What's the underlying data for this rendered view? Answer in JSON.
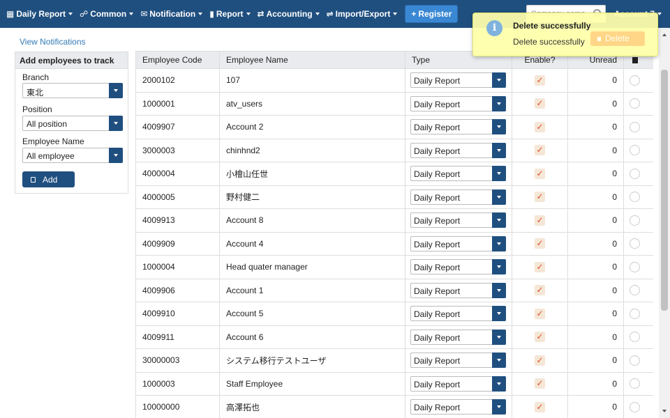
{
  "nav": {
    "items": [
      {
        "icon": "calendar-icon",
        "glyph": "▦",
        "label": "Daily Report",
        "caret": true
      },
      {
        "icon": "users-icon",
        "glyph": "☍",
        "label": "Common",
        "caret": true
      },
      {
        "icon": "envelope-icon",
        "glyph": "✉",
        "label": "Notification",
        "caret": true
      },
      {
        "icon": "bar-chart-icon",
        "glyph": "▮",
        "label": "Report",
        "caret": true
      },
      {
        "icon": "exchange-icon",
        "glyph": "⇄",
        "label": "Accounting",
        "caret": true
      },
      {
        "icon": "transfer-icon",
        "glyph": "⇌",
        "label": "Import/Export",
        "caret": true
      }
    ],
    "register_label": "Register",
    "search_placeholder": "Company name",
    "account_label": "Account 7"
  },
  "sidebar": {
    "view_notifications": "View Notifications",
    "panel_title": "Add employees to track",
    "branch_label": "Branch",
    "branch_value": "東北",
    "position_label": "Position",
    "position_value": "All position",
    "employee_name_label": "Employee Name",
    "employee_name_value": "All employee",
    "add_label": "Add"
  },
  "table": {
    "headers": {
      "code": "Employee Code",
      "name": "Employee Name",
      "type": "Type",
      "enable": "Enable?",
      "unread": "Unread"
    },
    "rows": [
      {
        "code": "2000102",
        "name": "107",
        "type": "Daily Report",
        "enabled": true,
        "unread": "0"
      },
      {
        "code": "1000001",
        "name": "atv_users",
        "type": "Daily Report",
        "enabled": true,
        "unread": "0"
      },
      {
        "code": "4009907",
        "name": "Account 2",
        "type": "Daily Report",
        "enabled": true,
        "unread": "0"
      },
      {
        "code": "3000003",
        "name": "chinhnd2",
        "type": "Daily Report",
        "enabled": true,
        "unread": "0"
      },
      {
        "code": "4000004",
        "name": "小檜山任世",
        "type": "Daily Report",
        "enabled": true,
        "unread": "0"
      },
      {
        "code": "4000005",
        "name": "野村健二",
        "type": "Daily Report",
        "enabled": true,
        "unread": "0"
      },
      {
        "code": "4009913",
        "name": "Account 8",
        "type": "Daily Report",
        "enabled": true,
        "unread": "0"
      },
      {
        "code": "4009909",
        "name": "Account 4",
        "type": "Daily Report",
        "enabled": true,
        "unread": "0"
      },
      {
        "code": "1000004",
        "name": "Head quater manager",
        "type": "Daily Report",
        "enabled": true,
        "unread": "0"
      },
      {
        "code": "4009906",
        "name": "Account 1",
        "type": "Daily Report",
        "enabled": true,
        "unread": "0"
      },
      {
        "code": "4009910",
        "name": "Account 5",
        "type": "Daily Report",
        "enabled": true,
        "unread": "0"
      },
      {
        "code": "4009911",
        "name": "Account 6",
        "type": "Daily Report",
        "enabled": true,
        "unread": "0"
      },
      {
        "code": "30000003",
        "name": "システム移行テストユーザ",
        "type": "Daily Report",
        "enabled": true,
        "unread": "0"
      },
      {
        "code": "1000003",
        "name": "Staff Employee",
        "type": "Daily Report",
        "enabled": true,
        "unread": "0"
      },
      {
        "code": "10000000",
        "name": "高澤拓也",
        "type": "Daily Report",
        "enabled": true,
        "unread": "0"
      }
    ]
  },
  "toast": {
    "title": "Delete successfully",
    "message": "Delete successfully",
    "delete_label": "Delete",
    "icon": "info-icon"
  },
  "colors": {
    "navbar": "#1f4f7f",
    "register": "#3a87d3",
    "link": "#337ab7",
    "checkmark": "#d9532b",
    "toast_bg": "#ffffaa"
  }
}
